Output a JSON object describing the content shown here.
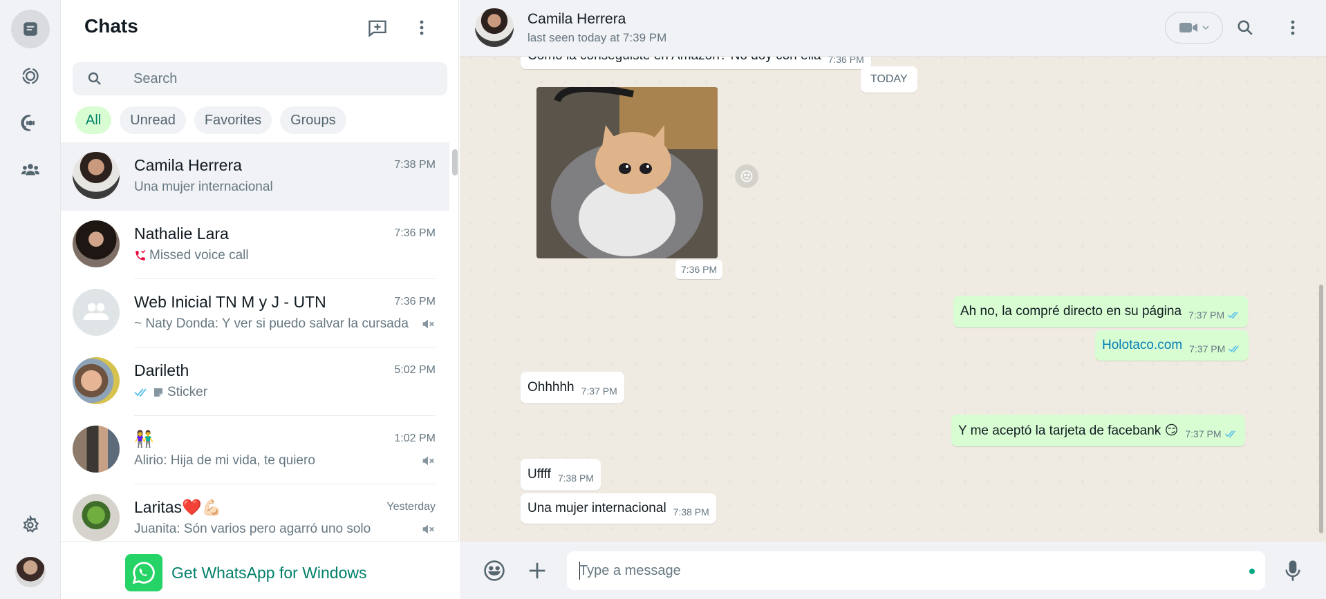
{
  "sidebar": {
    "title": "Chats",
    "search_placeholder": "Search",
    "filters": [
      {
        "label": "All",
        "active": true
      },
      {
        "label": "Unread",
        "active": false
      },
      {
        "label": "Favorites",
        "active": false
      },
      {
        "label": "Groups",
        "active": false
      }
    ],
    "chats": [
      {
        "name": "Camila Herrera",
        "time": "7:38 PM",
        "preview": "Una mujer internacional",
        "selected": true
      },
      {
        "name": "Nathalie Lara",
        "time": "7:36 PM",
        "preview": "Missed voice call",
        "preview_icon": "missed-call-icon"
      },
      {
        "name": "Web Inicial TN M y J - UTN",
        "time": "7:36 PM",
        "preview": "~ Naty Donda: Y ver si puedo salvar la cursada",
        "muted": true
      },
      {
        "name": "Darileth",
        "time": "5:02 PM",
        "preview": "Sticker",
        "preview_icon": "double-check-icon"
      },
      {
        "name": "👫",
        "time": "1:02 PM",
        "preview": "Alirio: Hija de mi vida, te quiero",
        "muted": true
      },
      {
        "name": "Laritas❤️💪🏻",
        "time": "Yesterday",
        "preview": "Juanita: Són varios pero agarró uno solo",
        "muted": true
      }
    ],
    "promo": "Get WhatsApp for Windows"
  },
  "conversation": {
    "contact_name": "Camila Herrera",
    "status": "last seen today at 7:39 PM",
    "partial_message": "Cómo la conseguiste en Amazon? No doy con ella",
    "partial_time": "7:36 PM",
    "day_label": "TODAY",
    "image_time": "7:36 PM",
    "messages": [
      {
        "dir": "out",
        "text": "Ah no, la compré directo en su página",
        "time": "7:37 PM"
      },
      {
        "dir": "out",
        "text": "Holotaco.com",
        "time": "7:37 PM",
        "link": true
      },
      {
        "dir": "in",
        "text": "Ohhhhh",
        "time": "7:37 PM"
      },
      {
        "dir": "out",
        "text": "Y me aceptó la tarjeta de facebank 😏",
        "time": "7:37 PM"
      },
      {
        "dir": "in",
        "text": "Uffff",
        "time": "7:38 PM"
      },
      {
        "dir": "in",
        "text": "Una mujer internacional",
        "time": "7:38 PM"
      }
    ],
    "composer_placeholder": "Type a message"
  },
  "colors": {
    "accent": "#00a884",
    "outgoing_bubble": "#d9fdd3",
    "incoming_bubble": "#ffffff",
    "chat_background": "#efeae2",
    "read_ticks": "#53bdeb"
  }
}
